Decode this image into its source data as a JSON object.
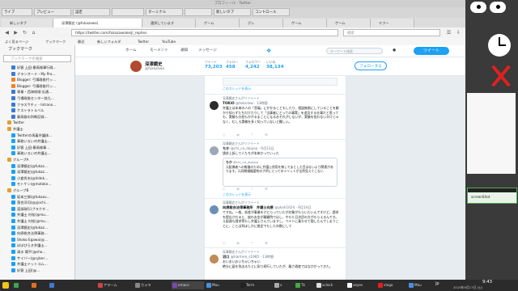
{
  "window_title": "プロフィール - Twitter",
  "taskbar_top": {
    "tabs": [
      "ライブ",
      "プレビュー",
      "設定",
      "",
      "ターミナル",
      "",
      "新しいタブ",
      "コントロール"
    ]
  },
  "browser": {
    "tabs": [
      "新しいタブ",
      "深澤鏡史 (@fukazawa)",
      "選択しています",
      "ゲーム",
      "グレ",
      "ゲーム",
      "ゲーム",
      "ヤフー"
    ],
    "url": "https://twitter.com/fukazawakeiji_replies",
    "search_placeholder": "検索",
    "bookmarks": [
      "よく見るページ",
      "ブックマーク",
      "最近",
      "新しいフォルダ",
      "Twitter",
      "YouTube"
    ]
  },
  "sidebar": {
    "title": "ブックマーク",
    "filter_placeholder": "ブックマークを検索",
    "items": [
      {
        "label": "好客 上田·最高検事行政…",
        "indent": 2,
        "color": "#3b7bd4"
      },
      {
        "label": "グランオード・My Pro…",
        "indent": 2,
        "color": "#3b7bd4"
      },
      {
        "label": "Blogger: 弓場政能代ッ…",
        "indent": 2,
        "color": "#f58220"
      },
      {
        "label": "Blogger: 弓場政能代ッ…",
        "indent": 2,
        "color": "#f58220"
      },
      {
        "label": "専業・西海地域·弘通…",
        "indent": 2,
        "color": "#3b7bd4"
      },
      {
        "label": "弓場政能センター前九…",
        "indent": 2,
        "color": "#3b7bd4"
      },
      {
        "label": "クラスウチィ - Intrano…",
        "indent": 2,
        "color": "#3b7bd4"
      },
      {
        "label": "ケストラトルベル",
        "indent": 2,
        "color": "#3b7bd4"
      },
      {
        "label": "最高裁の判断記録…",
        "indent": 2,
        "color": "#3b7bd4"
      },
      {
        "label": "Twitter",
        "indent": 1,
        "color": "#e0a030"
      },
      {
        "label": "弁護士",
        "indent": 1,
        "color": "#e0a030"
      },
      {
        "label": "Twitterの再着弁護体…",
        "indent": 2,
        "color": "#1da1f2"
      },
      {
        "label": "事務いろいの弁護士…",
        "indent": 2,
        "color": "#1da1f2"
      },
      {
        "label": "好客 上田·最高検事…",
        "indent": 2,
        "color": "#1da1f2"
      },
      {
        "label": "事務いろいの弁護士…",
        "indent": 2,
        "color": "#1da1f2"
      },
      {
        "label": "グループA",
        "indent": 1,
        "color": "#e0a030"
      },
      {
        "label": "深澤鏡史(@fukaz…",
        "indent": 2,
        "color": "#1da1f2"
      },
      {
        "label": "深澤鏡史(@fukaz…",
        "indent": 2,
        "color": "#1da1f2"
      },
      {
        "label": "小倉秀夫(@hidek…",
        "indent": 2,
        "color": "#1da1f2"
      },
      {
        "label": "モトケン(@motoke…",
        "indent": 2,
        "color": "#1da1f2"
      },
      {
        "label": "グループB",
        "indent": 1,
        "color": "#e0a030"
      },
      {
        "label": "坂本三郎(@fukazu…",
        "indent": 2,
        "color": "#1da1f2"
      },
      {
        "label": "落合洋司(@yjochi…",
        "indent": 2,
        "color": "#1da1f2"
      },
      {
        "label": "渡部政行(ブラクチ…",
        "indent": 2,
        "color": "#1da1f2"
      },
      {
        "label": "弁護士 村松(@mu…",
        "indent": 2,
        "color": "#1da1f2"
      },
      {
        "label": "弁護士 村松(@mu…",
        "indent": 2,
        "color": "#1da1f2"
      },
      {
        "label": "深澤鏡史(@fukaz…",
        "indent": 2,
        "color": "#1da1f2"
      },
      {
        "label": "向原総合法律事務…",
        "indent": 2,
        "color": "#1da1f2"
      },
      {
        "label": "Shoko Egawa(@…",
        "indent": 2,
        "color": "#1da1f2"
      },
      {
        "label": "ぼぼびらき弁護士…",
        "indent": 2,
        "color": "#1da1f2"
      },
      {
        "label": "清水 陽平(@sho…",
        "indent": 2,
        "color": "#1da1f2"
      },
      {
        "label": "サイバー(@cyber…",
        "indent": 2,
        "color": "#1da1f2"
      },
      {
        "label": "弁護士ドットコム…",
        "indent": 2,
        "color": "#1da1f2"
      },
      {
        "label": "好客 上田(@…",
        "indent": 2,
        "color": "#1da1f2"
      }
    ]
  },
  "twitter": {
    "nav": {
      "home": "ホーム",
      "moments": "モーメント",
      "notifications": "通知",
      "messages": "メッセージ"
    },
    "search_placeholder": "キーワード検索",
    "tweet_button": "ツイート",
    "profile": {
      "name": "深澤鏡史",
      "handle": "@fukazawa",
      "stats": [
        {
          "label": "ツイート",
          "value": "73,203"
        },
        {
          "label": "フォロー",
          "value": "458"
        },
        {
          "label": "フォロワー",
          "value": "4,242"
        },
        {
          "label": "いいね",
          "value": "38,134"
        }
      ],
      "follow_button": "フォローする"
    },
    "tweets": [
      {
        "context": "",
        "name": "",
        "handle": "",
        "text": "",
        "more": "このスレッドを表示"
      },
      {
        "context": "深澤鏡史さんがリツイート",
        "name": "TOKiO",
        "handle": "@tokiolaw · 13時間",
        "text": "弁護士は本来の人の「悲痛」にかかることもしたり、相談無限にしていることを解かり知らずたちだけたりして「当事者にとっての事実」を追及する仕事だと思っても、実験も分担もかかるまことになるおそれがしないが、実験を担わないかけじゃなく、むしろ実験を多く知っていないと難しい。",
        "more": ""
      },
      {
        "context": "深澤鏡史さんがリツイート",
        "name": "ちか",
        "handle": "@chi_co_daiyou · 9月13日",
        "text": "請求上訴して人たちが本来かっていった",
        "quote_name": "ちか",
        "quote_handle": "@chi_co_daiyou",
        "quote_text": "元配偶者への報復のために弁護士費用を無しでまとした目はないより関連があります。元同期婚権要約の子供にとってのメリットが全然見えてこない",
        "more": "このスレッドを表示"
      },
      {
        "context": "深澤鏡史さんがリツイート",
        "name": "向原総合法律事務所　弁護士向原",
        "handle": "@ykoh1024 · 9月14日",
        "text": "ですね。一般、仮差が事業をけどらっていたが対象がもらいたいんですけど、請求を提出されると、彼のお金が離職院ではし、やもた日次民の方がもらえるんです。え配達も請求等もし弁護士さんていますし、ベイトに乗わせて隠したんでしまうことに、ことは判ほしかに推定でもした年数にして",
        "more": ""
      },
      {
        "context": "深澤鏡史さんがリツイート",
        "name": "沼口",
        "handle": "@harmen_s1985 · 13時間",
        "text": "おいおいおいちゃいちゃい\n絶分に届を別出るたとに彩り続行していたが、離さ遺産ではなかかってきた。",
        "more": ""
      }
    ]
  },
  "desktop_right": {
    "labels": [
      "screenShot"
    ],
    "colors": {
      "red": "#e02020",
      "yellow": "#f5c518",
      "green": "#3aa655"
    }
  },
  "bottom_panel": {
    "tasks": [
      "アラーム",
      "カメラ",
      "emacs",
      "Mou",
      "Term",
      "x",
      "Tk",
      "xclock",
      "xeyes",
      "xlogo",
      "Mou"
    ],
    "clock": "9:43",
    "date": "2019年9月17日 (火)",
    "lang": "jp"
  }
}
